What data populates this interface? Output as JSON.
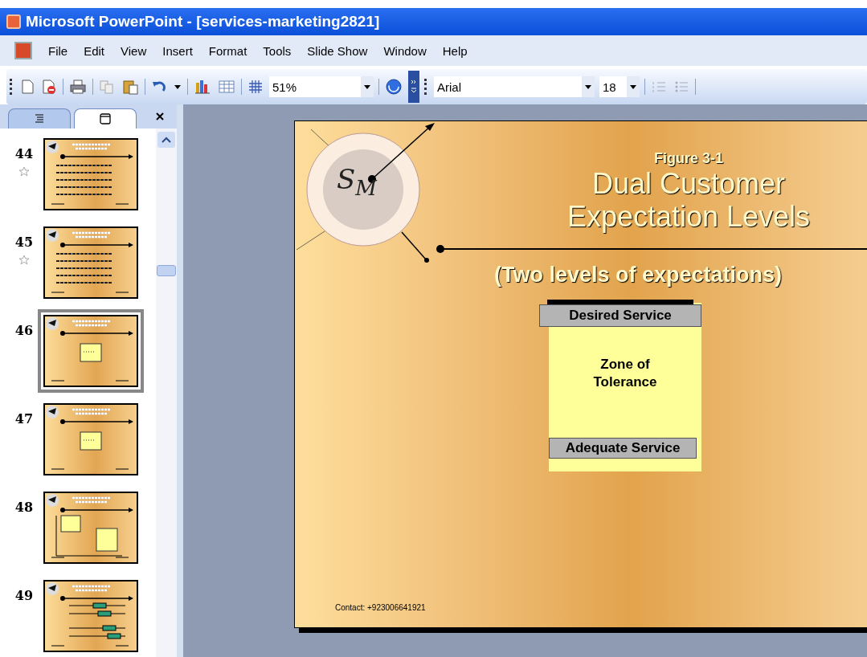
{
  "window": {
    "title": "Microsoft PowerPoint - [services-marketing2821]"
  },
  "menu": [
    "File",
    "Edit",
    "View",
    "Insert",
    "Format",
    "Tools",
    "Slide Show",
    "Window",
    "Help"
  ],
  "toolbar": {
    "zoom": "51%",
    "font": "Arial",
    "font_size": "18"
  },
  "pane_tabs": [
    {
      "kind": "outline",
      "selected": false
    },
    {
      "kind": "slides",
      "selected": true
    }
  ],
  "thumbnails": [
    {
      "number": "44",
      "selected": false,
      "animated": true,
      "kind": "bullets"
    },
    {
      "number": "45",
      "selected": false,
      "animated": true,
      "kind": "bullets"
    },
    {
      "number": "46",
      "selected": true,
      "animated": false,
      "kind": "box"
    },
    {
      "number": "47",
      "selected": false,
      "animated": false,
      "kind": "box"
    },
    {
      "number": "48",
      "selected": false,
      "animated": false,
      "kind": "two-box"
    },
    {
      "number": "49",
      "selected": false,
      "animated": false,
      "kind": "bars"
    }
  ],
  "slide": {
    "logo": "S$_{M}$",
    "figure": "Figure 3-1",
    "title": [
      "Dual Customer",
      "Expectation Levels"
    ],
    "subtitle": "(Two levels of expectations)",
    "diagram": {
      "top": "Desired Service",
      "middle": [
        "Zone of",
        "Tolerance"
      ],
      "bottom": "Adequate Service"
    },
    "footer": "Contact: +923006641921"
  }
}
